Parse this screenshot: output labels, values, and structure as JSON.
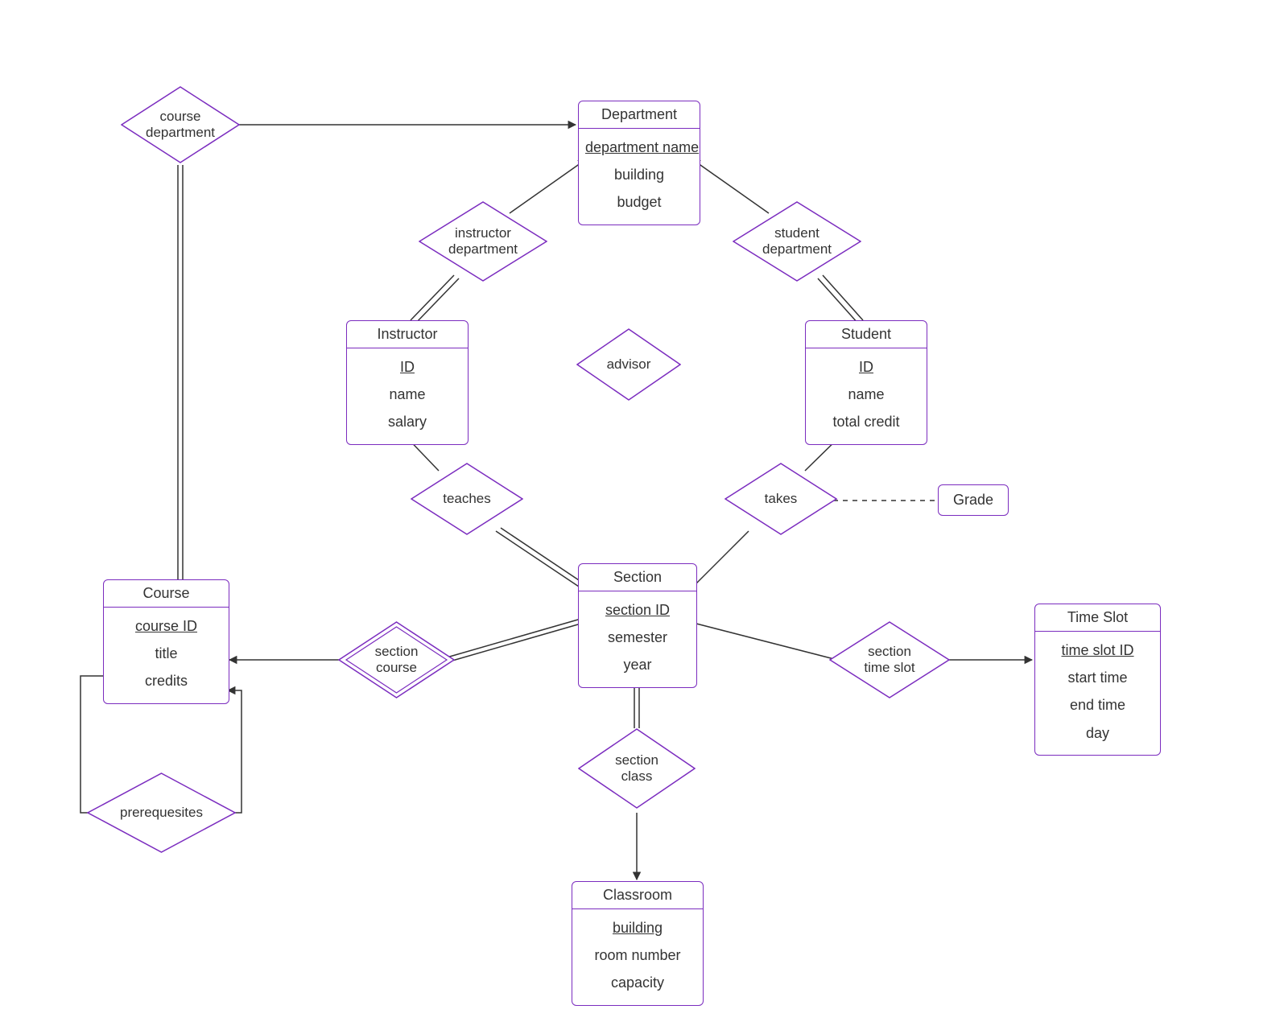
{
  "entities": {
    "department": {
      "title": "Department",
      "key": "department name",
      "a2": "building",
      "a3": "budget"
    },
    "instructor": {
      "title": "Instructor",
      "key": "ID",
      "a2": "name",
      "a3": "salary"
    },
    "student": {
      "title": "Student",
      "key": "ID",
      "a2": "name",
      "a3": "total credit"
    },
    "section": {
      "title": "Section",
      "key": "section ID",
      "a2": "semester",
      "a3": "year"
    },
    "course": {
      "title": "Course",
      "key": "course ID",
      "a2": "title",
      "a3": "credits"
    },
    "timeslot": {
      "title": "Time Slot",
      "key": "time slot ID",
      "a2": "start time",
      "a3": "end time",
      "a4": "day"
    },
    "classroom": {
      "title": "Classroom",
      "key": "building",
      "a2": "room number",
      "a3": "capacity"
    }
  },
  "relationships": {
    "course_department": "course department",
    "instructor_department": "instructor department",
    "student_department": "student department",
    "advisor": "advisor",
    "teaches": "teaches",
    "takes": "takes",
    "section_course": "section course",
    "section_timeslot": "section time slot",
    "section_class": "section class",
    "prerequisites": "prerequesites"
  },
  "attr_box": {
    "grade": "Grade"
  },
  "colors": {
    "border": "#7b2cbf",
    "line": "#333333"
  }
}
